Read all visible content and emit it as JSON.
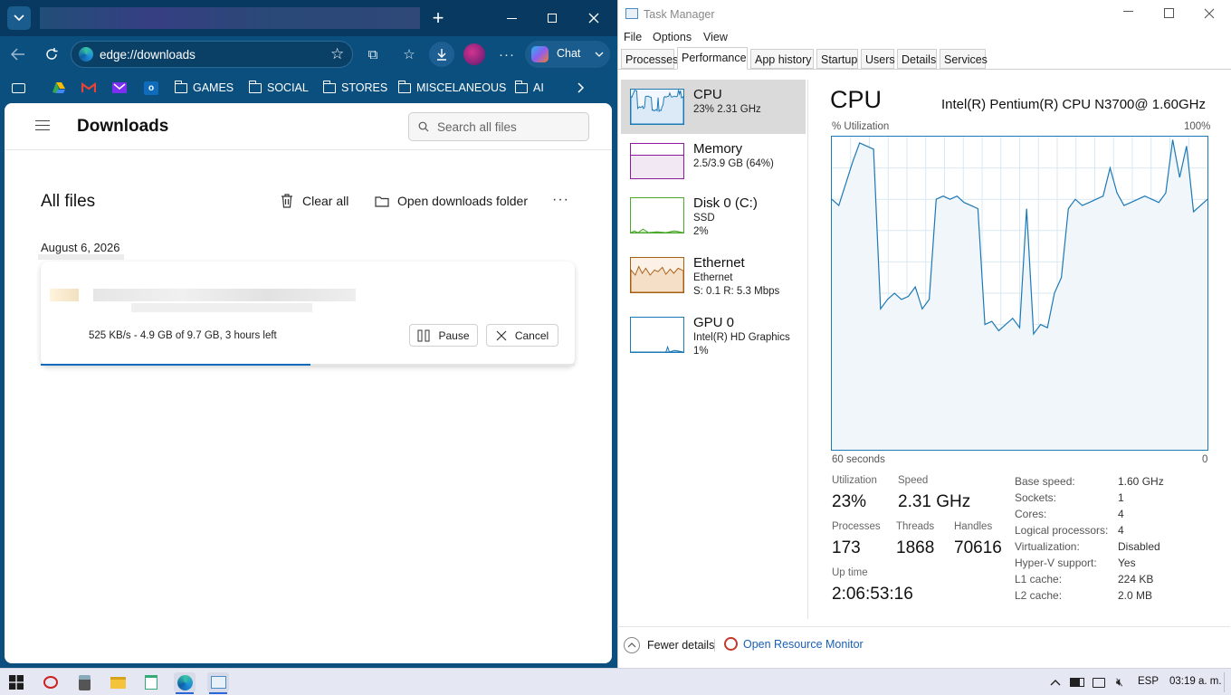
{
  "edge": {
    "address": "edge://downloads",
    "chat_label": "Chat",
    "favorites": [
      "GAMES",
      "SOCIAL",
      "STORES",
      "MISCELANEOUS",
      "AI"
    ],
    "page_title": "Downloads",
    "search_placeholder": "Search all files",
    "section_title": "All files",
    "clear_all": "Clear all",
    "open_folder": "Open downloads folder",
    "date": "August 6, 2026",
    "download": {
      "status": "525 KB/s - 4.9 GB of 9.7 GB, 3 hours left",
      "progress_percent": 50.5,
      "pause": "Pause",
      "cancel": "Cancel"
    }
  },
  "task_manager": {
    "title": "Task Manager",
    "menu": [
      "File",
      "Options",
      "View"
    ],
    "tabs": [
      "Processes",
      "Performance",
      "App history",
      "Startup",
      "Users",
      "Details",
      "Services"
    ],
    "sidebar": [
      {
        "title": "CPU",
        "lines": [
          "23%  2.31 GHz"
        ],
        "color": "#1b79b4"
      },
      {
        "title": "Memory",
        "lines": [
          "2.5/3.9 GB (64%)"
        ],
        "color": "#8b1a9c"
      },
      {
        "title": "Disk 0 (C:)",
        "lines": [
          "SSD",
          "2%"
        ],
        "color": "#4ca82d"
      },
      {
        "title": "Ethernet",
        "lines": [
          "Ethernet",
          "S: 0.1  R: 5.3 Mbps"
        ],
        "color": "#a75d13"
      },
      {
        "title": "GPU 0",
        "lines": [
          "Intel(R) HD Graphics",
          "1%"
        ],
        "color": "#1b79b4"
      }
    ],
    "heading": "CPU",
    "cpu_model": "Intel(R) Pentium(R) CPU N3700@ 1.60GHz",
    "util_label": "% Utilization",
    "max_label": "100%",
    "time_label": "60 seconds",
    "zero_label": "0",
    "stats": {
      "utilization_label": "Utilization",
      "utilization": "23%",
      "speed_label": "Speed",
      "speed": "2.31 GHz",
      "processes_label": "Processes",
      "processes": "173",
      "threads_label": "Threads",
      "threads": "1868",
      "handles_label": "Handles",
      "handles": "70616",
      "uptime_label": "Up time",
      "uptime": "2:06:53:16"
    },
    "details": [
      {
        "k": "Base speed:",
        "v": "1.60 GHz"
      },
      {
        "k": "Sockets:",
        "v": "1"
      },
      {
        "k": "Cores:",
        "v": "4"
      },
      {
        "k": "Logical processors:",
        "v": "4"
      },
      {
        "k": "Virtualization:",
        "v": "Disabled"
      },
      {
        "k": "Hyper-V support:",
        "v": "Yes"
      },
      {
        "k": "L1 cache:",
        "v": "224 KB"
      },
      {
        "k": "L2 cache:",
        "v": "2.0 MB"
      }
    ],
    "fewer_details": "Fewer details",
    "resource_monitor": "Open Resource Monitor",
    "cpu_history": [
      80,
      78,
      85,
      92,
      98,
      97,
      96,
      45,
      48,
      50,
      48,
      49,
      52,
      45,
      48,
      80,
      81,
      80,
      81,
      79,
      78,
      77,
      40,
      41,
      38,
      40,
      42,
      39,
      77,
      37,
      40,
      39,
      50,
      55,
      77,
      80,
      78,
      79,
      80,
      81,
      90,
      82,
      78,
      79,
      80,
      81,
      80,
      79,
      82,
      99,
      87,
      97,
      76,
      78,
      80
    ]
  },
  "taskbar": {
    "lang": "ESP",
    "time": "03:19 a. m."
  }
}
